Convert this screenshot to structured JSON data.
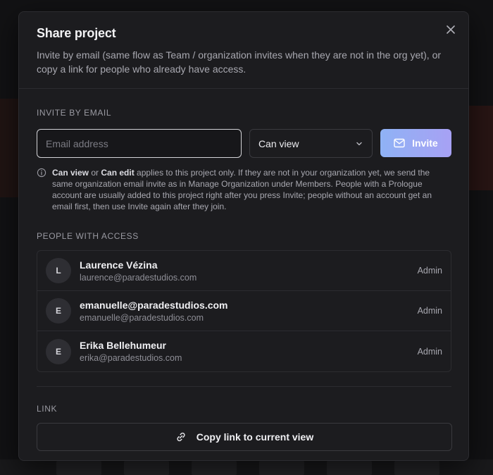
{
  "modal": {
    "title": "Share project",
    "subtitle": "Invite by email (same flow as Team / organization invites when they are not in the org yet), or copy a link for people who already have access.",
    "close_icon": "close-icon"
  },
  "invite": {
    "section_label": "INVITE BY EMAIL",
    "email_placeholder": "Email address",
    "email_value": "",
    "permission_selected": "Can view",
    "invite_button_label": "Invite",
    "note": {
      "can_view": "Can view",
      "or": " or ",
      "can_edit": "Can edit",
      "rest": " applies to this project only. If they are not in your organization yet, we send the same organization email invite as in Manage Organization under Members. People with a Prologue account are usually added to this project right after you press Invite; people without an account get an email first, then use Invite again after they join."
    }
  },
  "people": {
    "section_label": "PEOPLE WITH ACCESS",
    "items": [
      {
        "initial": "L",
        "name": "Laurence Vézina",
        "email": "laurence@paradestudios.com",
        "role": "Admin"
      },
      {
        "initial": "E",
        "name": "emanuelle@paradestudios.com",
        "email": "emanuelle@paradestudios.com",
        "role": "Admin"
      },
      {
        "initial": "E",
        "name": "Erika Bellehumeur",
        "email": "erika@paradestudios.com",
        "role": "Admin"
      }
    ]
  },
  "link": {
    "section_label": "LINK",
    "copy_button_label": "Copy link to current view"
  },
  "colors": {
    "accent_gradient_start": "#8fb2f5",
    "accent_gradient_end": "#a7a1f4",
    "modal_background": "#1c1c1f"
  }
}
